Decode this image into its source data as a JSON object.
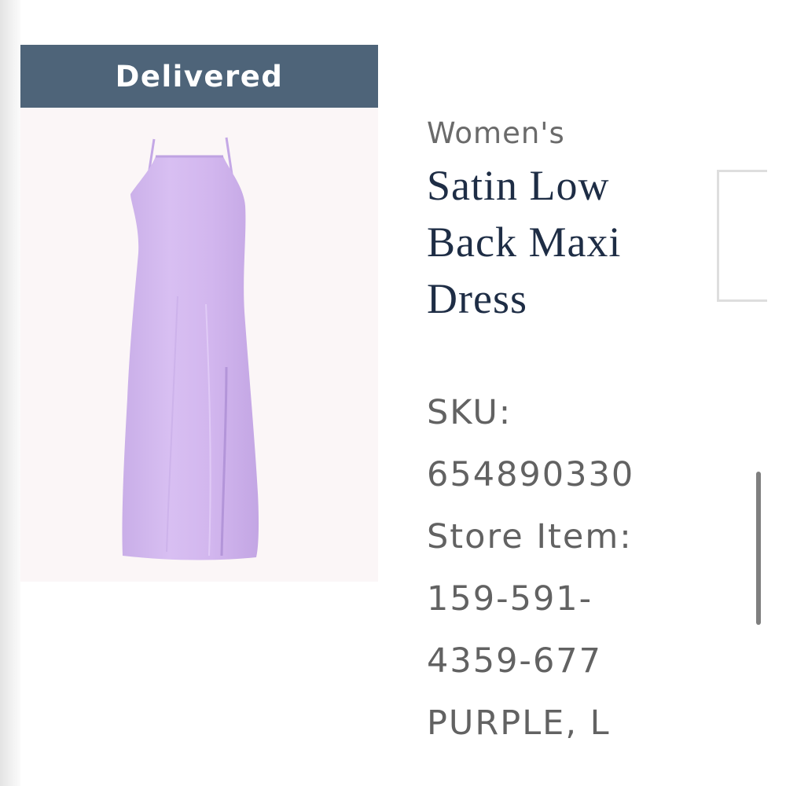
{
  "order_item": {
    "status": "Delivered",
    "status_color": "#4e6479",
    "image_icon": "purple-satin-dress-image",
    "category": "Women's",
    "title_lines": [
      "Satin Low",
      "Back Maxi",
      "Dress"
    ],
    "sku_label": "SKU:",
    "sku_value": "654890330",
    "store_item_label": "Store Item:",
    "store_item_lines": [
      "159-591-",
      "4359-677"
    ],
    "variant": "PURPLE, L"
  },
  "colors": {
    "dress": "#d4b9ef",
    "title_text": "#1e2d45",
    "detail_text": "#626262"
  }
}
